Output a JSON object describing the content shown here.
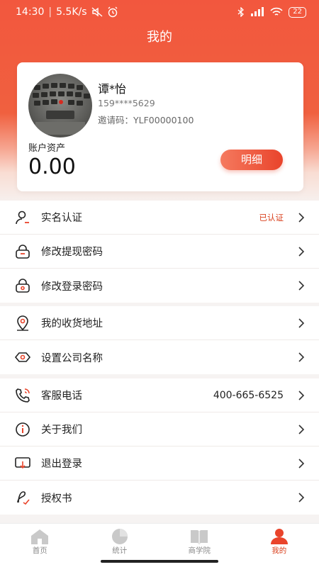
{
  "status_bar": {
    "time": "14:30",
    "speed": "5.5K/s",
    "battery": "22"
  },
  "header": {
    "title": "我的"
  },
  "profile": {
    "name": "谭*怡",
    "phone": "159****5629",
    "invite": "邀请码：YLF00000100",
    "assets_label": "账户资产",
    "assets_value": "0.00",
    "detail_button": "明细"
  },
  "menu_groups": [
    [
      {
        "key": "real-name",
        "icon": "user-verify-icon",
        "label": "实名认证",
        "value": "已认证"
      },
      {
        "key": "withdraw-password",
        "icon": "lock-icon",
        "label": "修改提现密码"
      },
      {
        "key": "login-password",
        "icon": "lock-icon",
        "label": "修改登录密码"
      }
    ],
    [
      {
        "key": "address",
        "icon": "location-pin-icon",
        "label": "我的收货地址"
      },
      {
        "key": "company-name",
        "icon": "eye-icon",
        "label": "设置公司名称"
      }
    ],
    [
      {
        "key": "service-phone",
        "icon": "phone-icon",
        "label": "客服电话",
        "value": "400-665-6525"
      },
      {
        "key": "about",
        "icon": "info-icon",
        "label": "关于我们"
      },
      {
        "key": "logout",
        "icon": "logout-icon",
        "label": "退出登录"
      },
      {
        "key": "authorization",
        "icon": "document-sign-icon",
        "label": "授权书"
      }
    ]
  ],
  "tabbar": [
    {
      "key": "home",
      "icon": "home-icon",
      "label": "首页"
    },
    {
      "key": "stats",
      "icon": "pie-chart-icon",
      "label": "统计"
    },
    {
      "key": "academy",
      "icon": "book-icon",
      "label": "商学院"
    },
    {
      "key": "mine",
      "icon": "profile-icon",
      "label": "我的",
      "active": true
    }
  ],
  "colors": {
    "accent": "#e9442b",
    "verified": "#d9411e"
  }
}
